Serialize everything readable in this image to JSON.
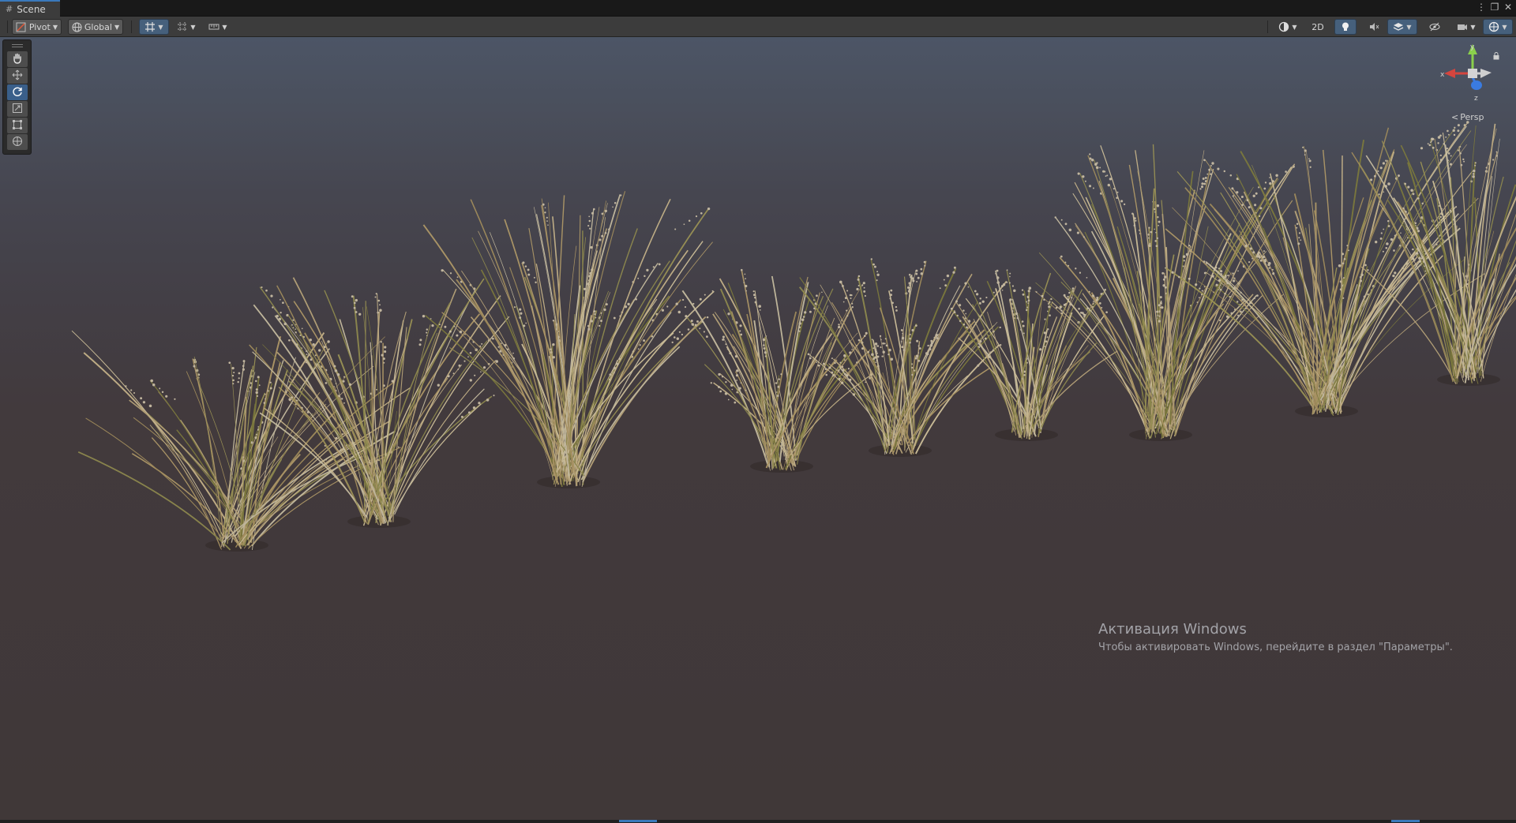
{
  "window": {
    "tab_title": "Scene"
  },
  "toolbar": {
    "pivot_label": "Pivot",
    "global_label": "Global",
    "mode_2d_label": "2D"
  },
  "tools": {
    "items": [
      "hand",
      "move",
      "rotate",
      "scale",
      "rect",
      "transform"
    ],
    "active": "rotate"
  },
  "gizmo": {
    "axis_x": "x",
    "axis_y": "y",
    "axis_z": "z",
    "projection_label": "Persp"
  },
  "watermark": {
    "title": "Активация Windows",
    "text": "Чтобы активировать Windows, перейдите в раздел \"Параметры\"."
  },
  "colors": {
    "accent": "#3a79bb",
    "axis_x": "#d4453e",
    "axis_y": "#8ad04c",
    "axis_z": "#3a7be0"
  }
}
